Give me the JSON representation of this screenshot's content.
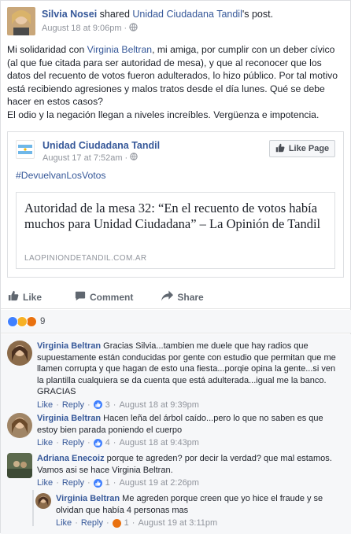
{
  "post": {
    "author": "Silvia Nosei",
    "shared_text": "shared",
    "shared_page": "Unidad Ciudadana Tandil",
    "shared_suffix": "'s post.",
    "time": "August 18 at 9:06pm",
    "message": {
      "p1_before": "Mi solidaridad con ",
      "p1_mention": "Virginia Beltran",
      "p1_after": ", mi amiga, por cumplir con un deber cívico (al que fue citada para ser autoridad de mesa), y que al reconocer que los datos del recuento de votos fueron adulterados, lo hizo público. Por tal motivo está recibiendo agresiones y malos tratos desde el día lunes. Qué se debe hacer en estos casos?",
      "p2": "El odio y la negación llegan a niveles increíbles. Vergüenza e impotencia."
    }
  },
  "shared": {
    "page_name": "Unidad Ciudadana Tandil",
    "time": "August 17 at 7:52am",
    "like_page": "Like Page",
    "hashtag": "#DevuelvanLosVotos",
    "link_title": "Autoridad de la mesa 32: “En el recuento de votos había muchos para Unidad Ciudadana” – La Opinión de Tandil",
    "link_domain": "LAOPINIONDETANDIL.COM.AR"
  },
  "actions": {
    "like": "Like",
    "comment": "Comment",
    "share": "Share"
  },
  "reactions": {
    "count": "9",
    "colors": [
      "#4080ff",
      "#f7b125",
      "#e9710f"
    ]
  },
  "comments": [
    {
      "author": "Virginia Beltran",
      "text": "Gracias Silvia...tambien me duele que hay radios que supuestamente están conducidas por gente con estudio que permitan que me llamen corrupta y que hagan de esto una fiesta...porqie opina la gente...si ven la plantilla cualquiera se da cuenta que está adulterada...igual me la banco. GRACIAS",
      "like": "Like",
      "reply": "Reply",
      "likes": "3",
      "time": "August 18 at 9:39pm"
    },
    {
      "author": "Virginia Beltran",
      "text": "Hacen leña del árbol caído...pero lo que no saben es que estoy bien parada poniendo el cuerpo",
      "like": "Like",
      "reply": "Reply",
      "likes": "4",
      "time": "August 18 at 9:43pm"
    },
    {
      "author": "Adriana Enecoiz",
      "text": "porque te agreden? por decir la verdad? que mal estamos. Vamos asi se hace Virginia Beltran.",
      "like": "Like",
      "reply": "Reply",
      "likes": "1",
      "time": "August 19 at 2:26pm"
    },
    {
      "author": "Virginia Beltran",
      "text": "Me agreden porque creen que yo hice el fraude y se olvidan que había 4 personas mas",
      "like": "Like",
      "reply": "Reply",
      "likes": "1",
      "time": "August 19 at 3:11pm"
    }
  ]
}
